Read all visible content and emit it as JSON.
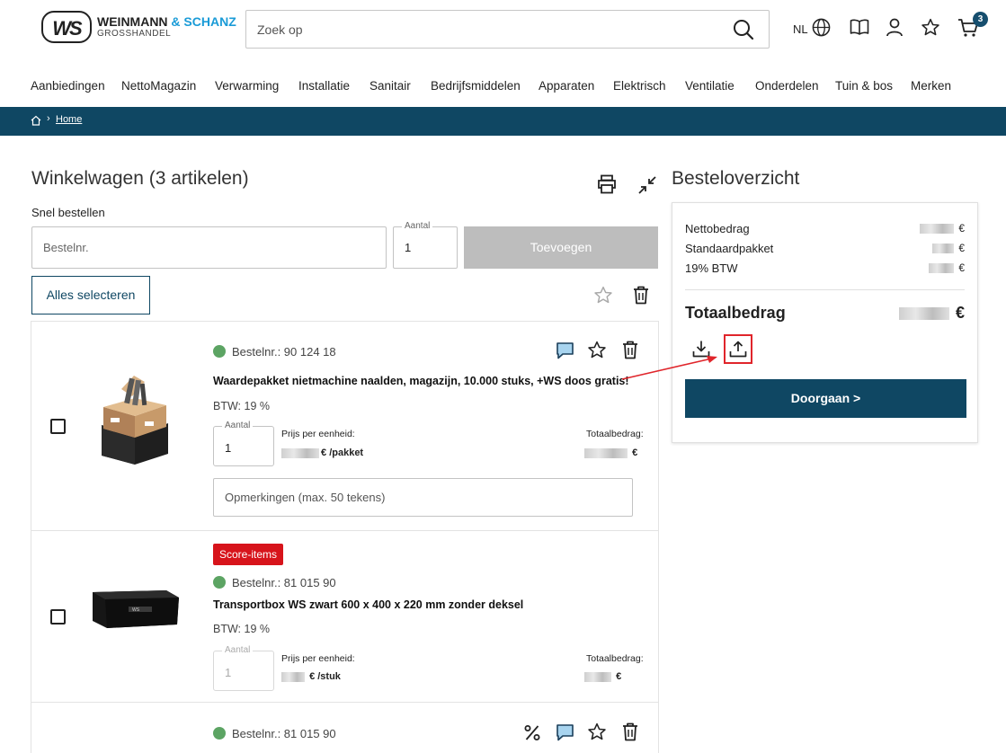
{
  "header": {
    "logo": {
      "mark": "WS",
      "name_part1": "WEINMANN",
      "name_amp": " & SCHANZ",
      "sub": "GROSSHANDEL"
    },
    "search_placeholder": "Zoek op",
    "language": "NL",
    "cart_count": "3"
  },
  "nav": [
    "Aanbiedingen",
    "NettoMagazin",
    "Verwarming",
    "Installatie",
    "Sanitair",
    "Bedrijfsmiddelen",
    "Apparaten",
    "Elektrisch",
    "Ventilatie",
    "Onderdelen",
    "Tuin & bos",
    "Merken"
  ],
  "breadcrumb": {
    "home": "Home"
  },
  "cart": {
    "title": "Winkelwagen (3 artikelen)",
    "quick_order_label": "Snel bestellen",
    "order_nr_placeholder": "Bestelnr.",
    "qty_label": "Aantal",
    "qty_value": "1",
    "add_button": "Toevoegen",
    "select_all": "Alles selecteren"
  },
  "items": [
    {
      "order_nr": "Bestelnr.: 90 124 18",
      "title": "Waardepakket nietmachine naalden, magazijn, 10.000 stuks, +WS doos gratis!",
      "vat": "BTW: 19 %",
      "qty_label": "Aantal",
      "qty": "1",
      "unit_price_label": "Prijs per eenheid:",
      "currency": "€",
      "unit": "/pakket",
      "total_label": "Totaalbedrag:",
      "remark_placeholder": "Opmerkingen (max. 50 tekens)"
    },
    {
      "badge": "Score-items",
      "order_nr": "Bestelnr.: 81 015 90",
      "title": "Transportbox WS zwart 600 x 400 x 220 mm zonder deksel",
      "vat": "BTW: 19 %",
      "qty_label": "Aantal",
      "qty": "1",
      "unit_price_label": "Prijs per eenheid:",
      "currency": "€",
      "unit": "/stuk",
      "total_label": "Totaalbedrag:"
    },
    {
      "order_nr": "Bestelnr.: 81 015 90"
    }
  ],
  "summary": {
    "title": "Besteloverzicht",
    "net_label": "Nettobedrag",
    "package_label": "Standaardpakket",
    "vat_label": "19% BTW",
    "currency": "€",
    "total_label": "Totaalbedrag",
    "continue_button": "Doorgaan >"
  },
  "colors": {
    "brand_dark": "#0f4763",
    "accent_red": "#d7141b",
    "status_green": "#5ca463",
    "highlight": "#e0252b"
  }
}
